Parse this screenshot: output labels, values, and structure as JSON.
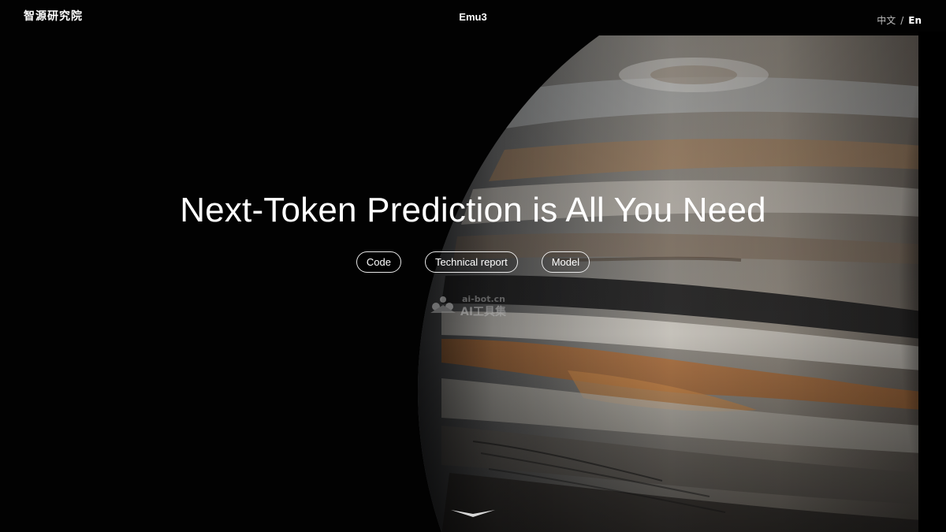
{
  "header": {
    "logo_text": "智源研究院",
    "site_title": "Emu3",
    "lang_zh": "中文",
    "lang_sep": "/",
    "lang_en": "En"
  },
  "hero": {
    "title": "Next-Token Prediction is All You Need",
    "buttons": [
      {
        "label": "Code"
      },
      {
        "label": "Technical report"
      },
      {
        "label": "Model"
      }
    ]
  },
  "watermark": {
    "url": "ai-bot.cn",
    "text": "AI工具集"
  },
  "icons": {
    "scroll": "chevron-down-icon",
    "watermark": "watermark-logo-icon"
  },
  "colors": {
    "background": "#000000",
    "text": "#ffffff",
    "pill_border": "#e8e8e8"
  }
}
